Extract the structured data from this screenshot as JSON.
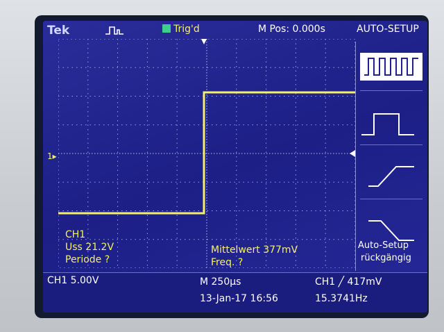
{
  "header": {
    "brand": "Tek",
    "trigger_status": "Trig'd",
    "horizontal_position": "M Pos: 0.000s",
    "menu_title": "AUTO-SETUP"
  },
  "channel_marker": "1",
  "measurements": {
    "channel": "CH1",
    "peak_to_peak": "Uss 21.2V",
    "period": "Periode ?",
    "mean": "Mittelwert 377mV",
    "frequency": "Freq. ?"
  },
  "menu": {
    "items": [
      {
        "icon": "multi-cycle-square-wave-icon"
      },
      {
        "icon": "single-pulse-icon"
      },
      {
        "icon": "rising-edge-icon"
      },
      {
        "icon": "falling-edge-icon"
      }
    ],
    "undo_label_line1": "Auto-Setup",
    "undo_label_line2": "rückgängig"
  },
  "footer": {
    "ch1_scale": "CH1  5.00V",
    "timebase": "M 250µs",
    "date_time": "13-Jan-17 16:56",
    "trigger": "CH1 ╱ 417mV",
    "trigger_frequency": "15.3741Hz"
  },
  "colors": {
    "screen_bg": "#20228a",
    "trace": "#f4f06a",
    "grid": "#9aa0e6",
    "trigger_indicator": "#3cd08a"
  }
}
